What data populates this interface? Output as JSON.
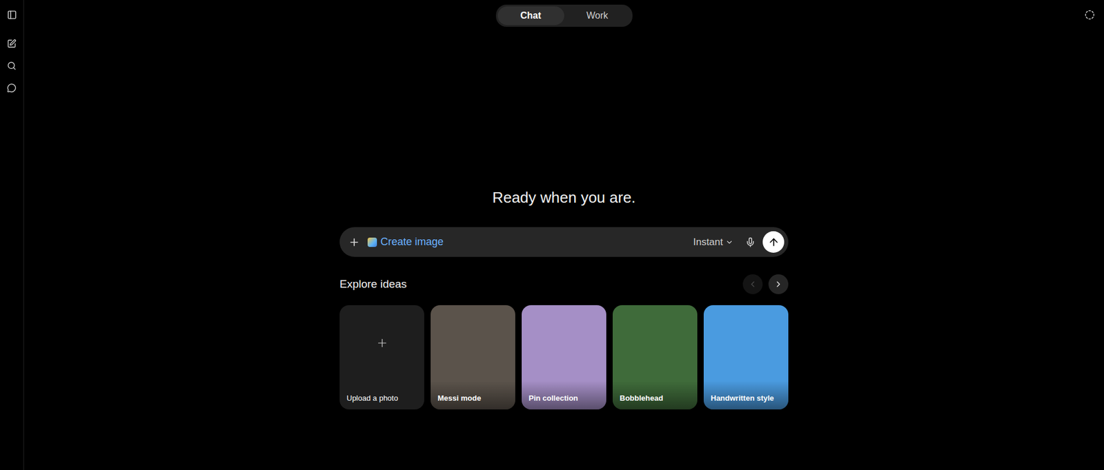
{
  "tabs": [
    {
      "label": "Chat",
      "selected": true
    },
    {
      "label": "Work",
      "selected": false
    }
  ],
  "heading": "Ready when you are.",
  "composer": {
    "chip": "Create image",
    "model": "Instant"
  },
  "explore": {
    "title": "Explore ideas",
    "prev": {
      "disabled": true
    },
    "next": {
      "disabled": false
    }
  },
  "cards": [
    {
      "label": "Upload a photo",
      "kind": "upload",
      "color": "#1e1e1e"
    },
    {
      "label": "Messi mode",
      "kind": "photo",
      "color": "#5b534b"
    },
    {
      "label": "Pin collection",
      "kind": "photo",
      "color": "#a58fc6"
    },
    {
      "label": "Bobblehead",
      "kind": "photo",
      "color": "#3f6b3a"
    },
    {
      "label": "Handwritten style",
      "kind": "photo",
      "color": "#4a9be0"
    }
  ]
}
